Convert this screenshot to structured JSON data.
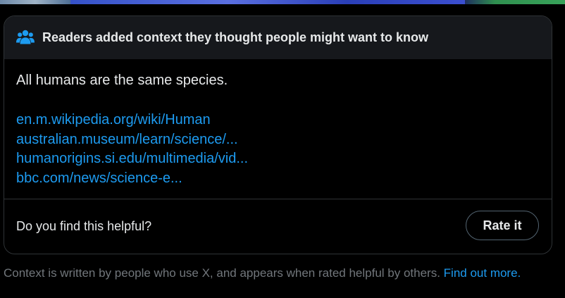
{
  "note": {
    "header_title": "Readers added context they thought people might want to know",
    "header_icon": "people-icon",
    "body": "All humans are the same species.",
    "sources": [
      "en.m.wikipedia.org/wiki/Human",
      "australian.museum/learn/science/...",
      "humanorigins.si.edu/multimedia/vid...",
      "bbc.com/news/science-e..."
    ],
    "helpful_question": "Do you find this helpful?",
    "rate_button_label": "Rate it"
  },
  "footer": {
    "text": "Context is written by people who use X, and appears when rated helpful by others.",
    "link_label": "Find out more."
  },
  "colors": {
    "background": "#000000",
    "header_background": "#16181c",
    "border": "#2f3336",
    "text_primary": "#e7e9ea",
    "text_secondary": "#71767b",
    "link": "#1d9bf0",
    "icon": "#1d9bf0"
  }
}
